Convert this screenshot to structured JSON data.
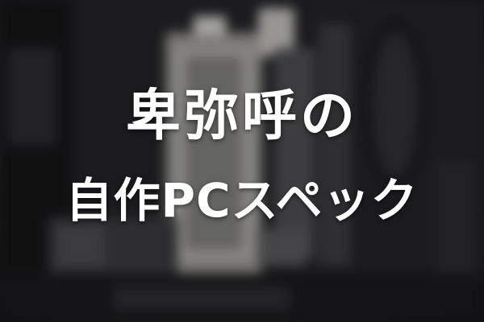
{
  "title": {
    "line1": "卑弥呼の",
    "line2": "自作PCスペック"
  },
  "background": {
    "subject": "blurred-pc-case-interior-photo"
  },
  "colors": {
    "text": "#ffffff",
    "background_dark": "#1a1a1c"
  }
}
